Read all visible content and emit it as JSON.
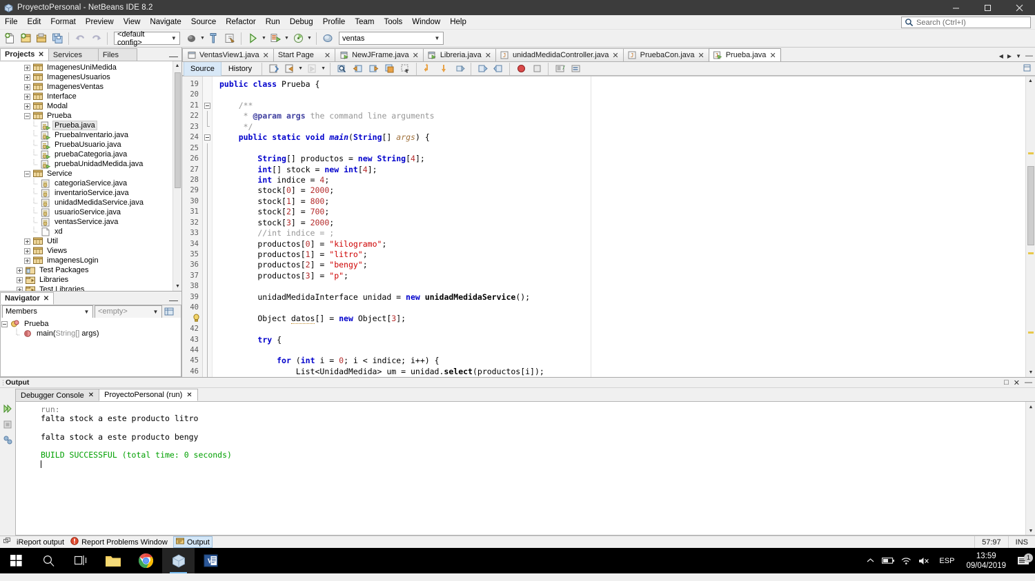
{
  "window": {
    "title": "ProyectoPersonal - NetBeans IDE 8.2",
    "icon": "netbeans-cube-icon",
    "minimize": "minimize-icon",
    "maximize": "maximize-icon",
    "close": "close-icon"
  },
  "menubar": {
    "items": [
      "File",
      "Edit",
      "Format",
      "Preview",
      "View",
      "Navigate",
      "Source",
      "Refactor",
      "Run",
      "Debug",
      "Profile",
      "Team",
      "Tools",
      "Window",
      "Help"
    ]
  },
  "search": {
    "placeholder": "Search (Ctrl+I)",
    "value": "",
    "icon": "search-icon"
  },
  "toolbar": {
    "config_combo": {
      "value": "<default config>"
    },
    "project_combo": {
      "value": "ventas"
    },
    "buttons": [
      "new-file-icon",
      "new-project-icon",
      "open-project-icon",
      "save-all-icon",
      "undo-icon",
      "redo-icon",
      "build-project-icon",
      "clean-build-icon",
      "generate-javadoc-icon",
      "run-project-icon",
      "debug-project-icon",
      "profile-project-icon",
      "set-browser-icon"
    ]
  },
  "left_panel": {
    "tabs": [
      {
        "label": "Projects",
        "active": true,
        "closable": true
      },
      {
        "label": "Services",
        "active": false,
        "closable": false
      },
      {
        "label": "Files",
        "active": false,
        "closable": false
      }
    ],
    "minimize": "minimize-icon",
    "tree": [
      {
        "label": "ImagenesUniMedida",
        "indent": 2,
        "type": "package",
        "expand": "plus"
      },
      {
        "label": "ImagenesUsuarios",
        "indent": 2,
        "type": "package",
        "expand": "plus"
      },
      {
        "label": "ImagenesVentas",
        "indent": 2,
        "type": "package",
        "expand": "plus"
      },
      {
        "label": "Interface",
        "indent": 2,
        "type": "package",
        "expand": "plus"
      },
      {
        "label": "Modal",
        "indent": 2,
        "type": "package",
        "expand": "plus"
      },
      {
        "label": "Prueba",
        "indent": 2,
        "type": "package",
        "expand": "minus"
      },
      {
        "label": "Prueba.java",
        "indent": 3,
        "type": "java-main",
        "expand": "none",
        "selected": true
      },
      {
        "label": "PruebaInventario.java",
        "indent": 3,
        "type": "java-main",
        "expand": "none"
      },
      {
        "label": "PruebaUsuario.java",
        "indent": 3,
        "type": "java-main",
        "expand": "none"
      },
      {
        "label": "pruebaCategoria.java",
        "indent": 3,
        "type": "java-main",
        "expand": "none"
      },
      {
        "label": "pruebaUnidadMedida.java",
        "indent": 3,
        "type": "java-main",
        "expand": "none"
      },
      {
        "label": "Service",
        "indent": 2,
        "type": "package",
        "expand": "minus"
      },
      {
        "label": "categoriaService.java",
        "indent": 3,
        "type": "java",
        "expand": "none"
      },
      {
        "label": "inventarioService.java",
        "indent": 3,
        "type": "java",
        "expand": "none"
      },
      {
        "label": "unidadMedidaService.java",
        "indent": 3,
        "type": "java",
        "expand": "none"
      },
      {
        "label": "usuarioService.java",
        "indent": 3,
        "type": "java",
        "expand": "none"
      },
      {
        "label": "ventasService.java",
        "indent": 3,
        "type": "java",
        "expand": "none"
      },
      {
        "label": "xd",
        "indent": 3,
        "type": "file",
        "expand": "none"
      },
      {
        "label": "Util",
        "indent": 2,
        "type": "package",
        "expand": "plus"
      },
      {
        "label": "Views",
        "indent": 2,
        "type": "package",
        "expand": "plus"
      },
      {
        "label": "imagenesLogin",
        "indent": 2,
        "type": "package",
        "expand": "plus"
      },
      {
        "label": "Test Packages",
        "indent": 1,
        "type": "test-packages",
        "expand": "plus"
      },
      {
        "label": "Libraries",
        "indent": 1,
        "type": "libraries",
        "expand": "plus"
      },
      {
        "label": "Test Libraries",
        "indent": 1,
        "type": "libraries",
        "expand": "plus"
      }
    ]
  },
  "navigator": {
    "tab_label": "Navigator",
    "minimize": "minimize-icon",
    "view_combo": {
      "value": "Members"
    },
    "filter_combo": {
      "value": "<empty>"
    },
    "filter_button": "filters-icon",
    "tree": [
      {
        "label": "Prueba",
        "indent": 0,
        "type": "class",
        "expand": "minus"
      },
      {
        "label": "main(String[] args)",
        "indent": 1,
        "type": "method",
        "expand": "none",
        "gray_part": "String[]"
      }
    ]
  },
  "editor": {
    "tabs": [
      {
        "label": "VentasView1.java",
        "icon": "form-icon",
        "active": false
      },
      {
        "label": "Start Page",
        "icon": "none",
        "active": false
      },
      {
        "label": "NewJFrame.java",
        "icon": "form-run-icon",
        "active": false
      },
      {
        "label": "Libreria.java",
        "icon": "form-run-icon",
        "active": false
      },
      {
        "label": "unidadMedidaController.java",
        "icon": "java-icon",
        "active": false
      },
      {
        "label": "PruebaCon.java",
        "icon": "java-icon",
        "active": false
      },
      {
        "label": "Prueba.java",
        "icon": "java-main-icon",
        "active": true
      }
    ],
    "view_tabs": [
      {
        "label": "Source",
        "active": true
      },
      {
        "label": "History",
        "active": false
      }
    ],
    "toolbar_buttons": [
      "last-edit-icon",
      "back-icon",
      "forward-icon",
      "find-selection-icon",
      "previous-bookmark-icon",
      "next-bookmark-icon",
      "toggle-bookmark-icon",
      "toggle-rectangular-selection-icon",
      "shift-line-left-icon",
      "shift-line-right-icon",
      "start-macro-recording-icon",
      "stop-macro-recording-icon",
      "comment-icon",
      "uncomment-icon"
    ],
    "gutter_lines": [
      "19",
      "20",
      "21",
      "22",
      "23",
      "24",
      "25",
      "26",
      "27",
      "28",
      "29",
      "30",
      "31",
      "32",
      "33",
      "34",
      "35",
      "36",
      "37",
      "38",
      "39",
      "40",
      "41",
      "42",
      "43",
      "44",
      "45",
      "46"
    ],
    "warning_line": "41",
    "code_lines": [
      "public class Prueba {",
      "",
      "    /**",
      "     * @param args the command line arguments",
      "     */",
      "    public static void main(String[] args) {",
      "",
      "        String[] productos = new String[4];",
      "        int[] stock = new int[4];",
      "        int indice = 4;",
      "        stock[0] = 2000;",
      "        stock[1] = 800;",
      "        stock[2] = 700;",
      "        stock[3] = 2000;",
      "        //int indice = ;",
      "        productos[0] = \"kilogramo\";",
      "        productos[1] = \"litro\";",
      "        productos[2] = \"bengy\";",
      "        productos[3] = \"p\";",
      "",
      "        unidadMedidaInterface unidad = new unidadMedidaService();",
      "",
      "        Object datos[] = new Object[3];",
      "",
      "        try {",
      "",
      "            for (int i = 0; i < indice; i++) {",
      "                List<UnidadMedida> um = unidad.select(productos[i]);"
    ]
  },
  "output": {
    "panel_title": "Output",
    "float_icon": "float-icon",
    "minimize_icon": "minimize-icon",
    "close_icon": "close-icon",
    "tabs": [
      {
        "label": "Debugger Console",
        "active": false
      },
      {
        "label": "ProyectoPersonal (run)",
        "active": true
      }
    ],
    "gutter_buttons": [
      "rerun-icon",
      "stop-icon",
      "debug-icon"
    ],
    "lines": [
      {
        "text": "run:",
        "style": "run"
      },
      {
        "text": "falta stock a este producto litro",
        "style": "normal"
      },
      {
        "text": "",
        "style": "normal"
      },
      {
        "text": "falta stock a este producto bengy",
        "style": "normal"
      },
      {
        "text": "",
        "style": "normal"
      },
      {
        "text": "BUILD SUCCESSFUL (total time: 0 seconds)",
        "style": "ok"
      }
    ]
  },
  "statusbar": {
    "grip_icon": "grip-icon",
    "items": [
      {
        "label": "iReport output",
        "icon": "none",
        "active": false
      },
      {
        "label": "Report Problems Window",
        "icon": "error-icon",
        "active": false
      },
      {
        "label": "Output",
        "icon": "output-icon",
        "active": true
      }
    ],
    "caret_position": "57:97",
    "insert_mode": "INS"
  },
  "taskbar": {
    "items": [
      {
        "name": "start-button",
        "icon": "windows-logo-icon",
        "active": false
      },
      {
        "name": "search-taskbar",
        "icon": "search-icon",
        "active": false
      },
      {
        "name": "task-view",
        "icon": "task-view-icon",
        "active": false
      },
      {
        "name": "file-explorer",
        "icon": "folder-icon",
        "active": false,
        "running": true
      },
      {
        "name": "google-chrome",
        "icon": "chrome-icon",
        "active": false,
        "running": true
      },
      {
        "name": "netbeans",
        "icon": "netbeans-cube-icon",
        "active": true,
        "running": true
      },
      {
        "name": "microsoft-word",
        "icon": "word-icon",
        "active": false,
        "running": true
      }
    ],
    "tray": {
      "chevron": "chevron-up-icon",
      "battery": "battery-icon",
      "network": "wifi-icon",
      "volume": "volume-muted-icon",
      "language": "ESP",
      "time": "13:59",
      "date": "09/04/2019",
      "notifications_icon": "notification-icon",
      "notifications_count": "1"
    }
  },
  "colors": {
    "titlebar_bg": "#3c3c3c",
    "chrome_bg": "#f0f0f0",
    "accent_blue": "#d8e8f7",
    "keyword": "#0000cc",
    "string": "#ce0000",
    "comment": "#969696",
    "build_ok": "#00a000",
    "taskbar_bg": "#000000"
  }
}
